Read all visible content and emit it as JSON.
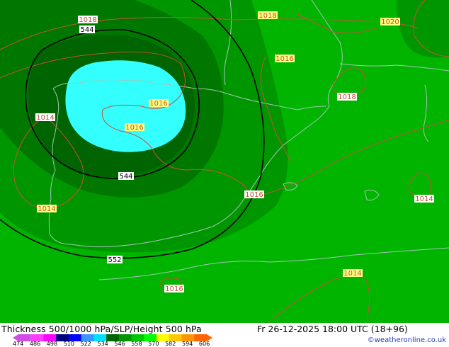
{
  "map": {
    "colors": {
      "sea_land_base": "#00b400",
      "band_546": "#009600",
      "band_540": "#007800",
      "band_534": "#006400",
      "band_522": "#33ffff",
      "band_528_ne": "#00a000",
      "thickness_contour": "#000000",
      "slp_contour": "#c8503c",
      "coastline": "#a0c8b4"
    },
    "thickness_labels": [
      {
        "text": "544",
        "id": "thk-544-top"
      },
      {
        "text": "544",
        "id": "thk-544-bottom"
      },
      {
        "text": "552",
        "id": "thk-552"
      }
    ],
    "slp_labels": [
      {
        "text": "1018",
        "id": "slp-1018-a"
      },
      {
        "text": "1018",
        "id": "slp-1018-b"
      },
      {
        "text": "1020",
        "id": "slp-1020"
      },
      {
        "text": "1016",
        "id": "slp-1016-a"
      },
      {
        "text": "1018",
        "id": "slp-1018-c"
      },
      {
        "text": "1016",
        "id": "slp-1016-b"
      },
      {
        "text": "1016",
        "id": "slp-1016-c"
      },
      {
        "text": "1014",
        "id": "slp-1014-a"
      },
      {
        "text": "1016",
        "id": "slp-1016-d"
      },
      {
        "text": "1014",
        "id": "slp-1014-b"
      },
      {
        "text": "1014",
        "id": "slp-1014-c"
      },
      {
        "text": "1016",
        "id": "slp-1016-e"
      },
      {
        "text": "1014",
        "id": "slp-1014-d"
      }
    ]
  },
  "footer": {
    "title": "Thickness 500/1000 hPa/SLP/Height 500 hPa",
    "datetime": "Fr 26-12-2025 18:00 UTC (18+96)",
    "credit": "©weatheronline.co.uk",
    "scale_ticks": [
      "474",
      "486",
      "498",
      "510",
      "522",
      "534",
      "546",
      "558",
      "570",
      "582",
      "594",
      "606"
    ],
    "scale_colors": [
      "#d24be6",
      "#ff3cff",
      "#ff00ff",
      "#00007d",
      "#0000ff",
      "#3c96ff",
      "#00e1ff",
      "#006400",
      "#009600",
      "#00c800",
      "#00ff00",
      "#ffff00",
      "#ffc800",
      "#ff9600",
      "#ff6400"
    ]
  }
}
